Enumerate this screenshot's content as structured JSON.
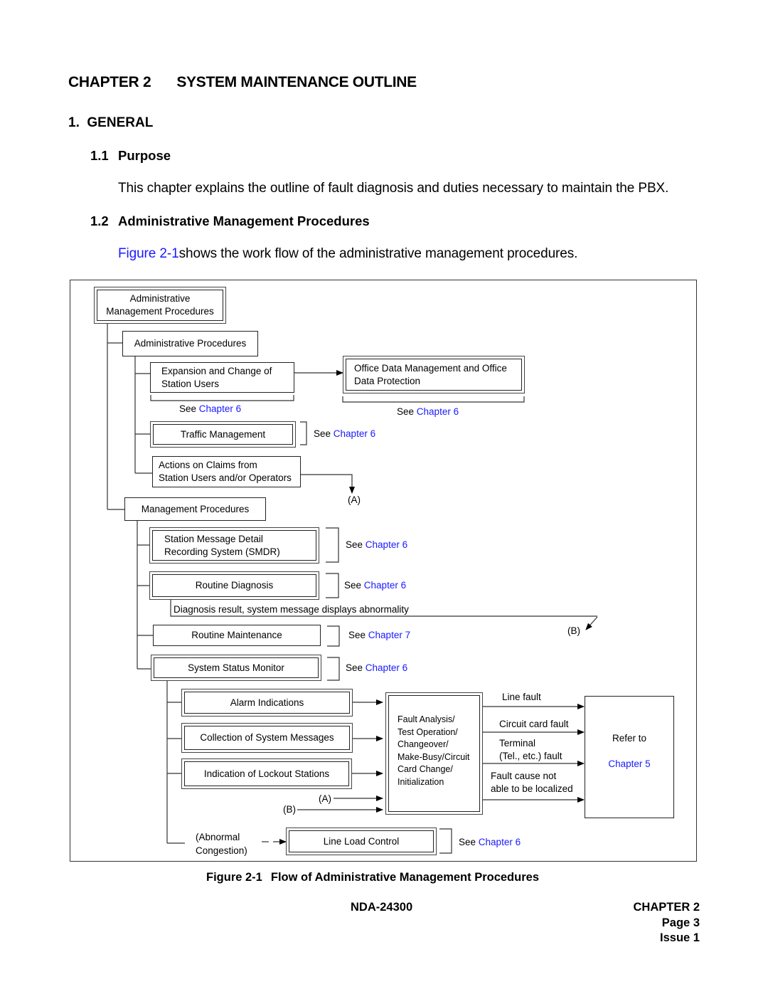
{
  "header": {
    "chapter_label": "CHAPTER 2",
    "chapter_title": "SYSTEM MAINTENANCE OUTLINE"
  },
  "sections": {
    "general": "1.  GENERAL",
    "purpose_num": "1.1",
    "purpose_title": "Purpose",
    "purpose_text": "This chapter explains the outline of fault diagnosis and duties necessary to maintain the PBX.",
    "admin_num": "1.2",
    "admin_title": "Administrative Management Procedures",
    "admin_link": "Figure 2-1",
    "admin_text": "shows the work flow of the administrative management procedures."
  },
  "diagram": {
    "root": [
      "Administrative",
      "Management Procedures"
    ],
    "admin_procedures": "Administrative Procedures",
    "expansion": [
      "Expansion and Change of",
      "Station Users"
    ],
    "office_data": [
      "Office Data Management and Office",
      "Data Protection"
    ],
    "traffic": "Traffic Management",
    "claims": [
      "Actions on Claims from",
      "Station Users and/or Operators"
    ],
    "management_procedures": "Management Procedures",
    "smdr": [
      "Station Message Detail",
      "Recording System (SMDR)"
    ],
    "routine_diagnosis": "Routine Diagnosis",
    "diagnosis_note": "Diagnosis result, system message displays abnormality",
    "routine_maintenance": "Routine Maintenance",
    "status_monitor": "System Status Monitor",
    "alarm": "Alarm Indications",
    "collection": "Collection of System Messages",
    "lockout": "Indication of Lockout Stations",
    "fault_box": [
      "Fault Analysis/",
      "Test Operation/",
      "Changeover/",
      "Make-Busy/Circuit",
      "Card Change/",
      "Initialization"
    ],
    "line_fault": "Line fault",
    "circuit_fault": "Circuit card fault",
    "terminal_fault": [
      "Terminal",
      "(Tel., etc.) fault"
    ],
    "not_localized": [
      "Fault cause not",
      "able to be localized"
    ],
    "refer_to": "Refer to",
    "chapter5": "Chapter 5",
    "abnormal": [
      "(Abnormal",
      "Congestion)"
    ],
    "line_load": "Line Load Control",
    "marker_a": "(A)",
    "marker_b": "(B)",
    "see": "See",
    "refs": {
      "expansion": "Chapter 6",
      "office_data": "Chapter 6",
      "traffic": "Chapter 6",
      "smdr": "Chapter 6",
      "routine_diagnosis": "Chapter 6",
      "routine_maintenance": "Chapter 7",
      "status_monitor": "Chapter 6",
      "line_load": "Chapter 6"
    }
  },
  "figure_caption": {
    "number": "Figure 2-1",
    "title": "Flow of Administrative Management Procedures"
  },
  "footer": {
    "doc_id": "NDA-24300",
    "chapter": "CHAPTER 2",
    "page": "Page 3",
    "issue": "Issue 1"
  },
  "colors": {
    "link": "#1a1aff",
    "text": "#000000"
  }
}
